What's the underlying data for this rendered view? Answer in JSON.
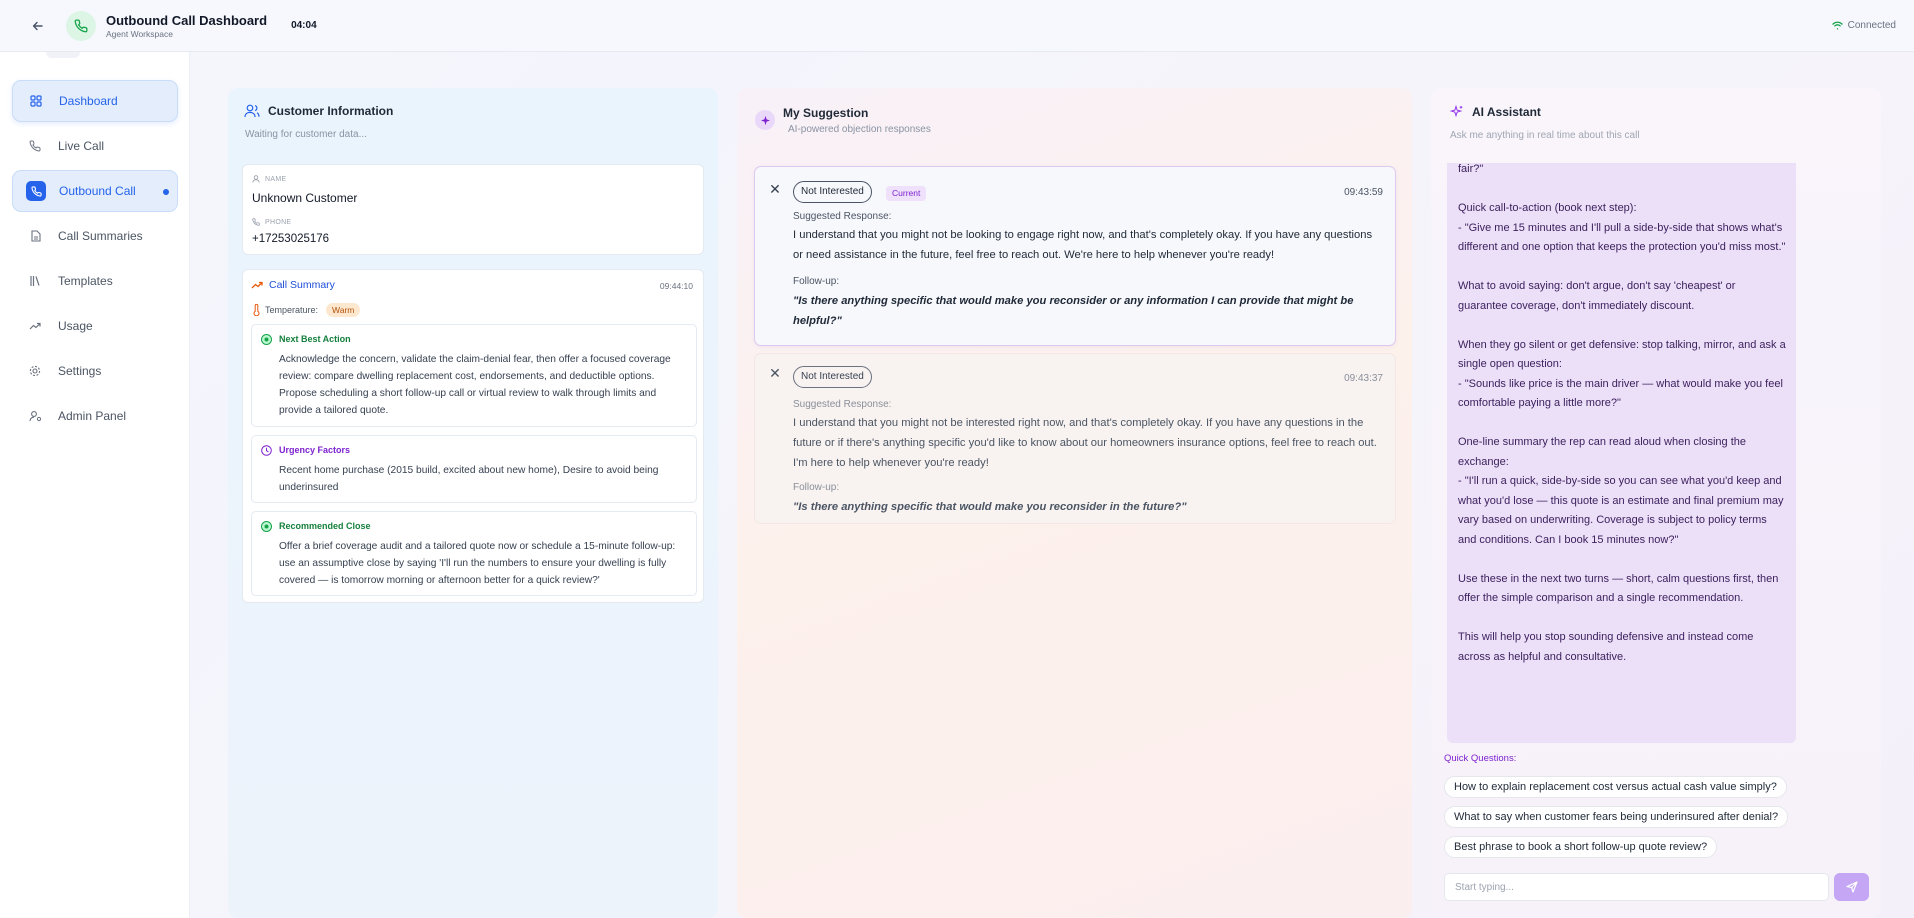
{
  "header": {
    "title": "Outbound Call Dashboard",
    "subtitle": "Agent Workspace",
    "timer": "04:04",
    "status": "Connected",
    "icons": [
      "back-arrow-icon",
      "phone-icon",
      "wifi-icon"
    ]
  },
  "sidebar": {
    "items": [
      {
        "label": "Dashboard",
        "icon": "grid-icon"
      },
      {
        "label": "Live Call",
        "icon": "phone-icon"
      },
      {
        "label": "Outbound Call",
        "icon": "phone-outgoing-icon"
      },
      {
        "label": "Call Summaries",
        "icon": "file-icon"
      },
      {
        "label": "Templates",
        "icon": "library-icon"
      },
      {
        "label": "Usage",
        "icon": "trend-icon"
      },
      {
        "label": "Settings",
        "icon": "gear-icon"
      },
      {
        "label": "Admin Panel",
        "icon": "user-cog-icon"
      }
    ]
  },
  "customer": {
    "title": "Customer Information",
    "subtitle": "Waiting for customer data...",
    "name_caption": "NAME",
    "name": "Unknown Customer",
    "phone_caption": "PHONE",
    "phone": "+17253025176",
    "summary": {
      "title": "Call Summary",
      "time": "09:44:10",
      "temperature_label": "Temperature:",
      "temperature": "Warm",
      "next_best_action": {
        "title": "Next Best Action",
        "text": "Acknowledge the concern, validate the claim-denial fear, then offer a focused coverage review: compare dwelling replacement cost, endorsements, and deductible options. Propose scheduling a short follow-up call or virtual review to walk through limits and provide a tailored quote."
      },
      "urgency": {
        "title": "Urgency Factors",
        "text": "Recent home purchase (2015 build, excited about new home), Desire to avoid being underinsured"
      },
      "close": {
        "title": "Recommended Close",
        "text": "Offer a brief coverage audit and a tailored quote now or schedule a 15-minute follow-up: use an assumptive close by saying 'I'll run the numbers to ensure your dwelling is fully covered — is tomorrow morning or afternoon better for a quick review?'"
      }
    }
  },
  "suggestion": {
    "title": "My Suggestion",
    "subtitle": "AI-powered objection responses",
    "cards": [
      {
        "tag": "Not Interested",
        "current": "Current",
        "time": "09:43:59",
        "response_label": "Suggested Response:",
        "response": "I understand that you might not be looking to engage right now, and that's completely okay. If you have any questions or need assistance in the future, feel free to reach out. We're here to help whenever you're ready!",
        "followup_label": "Follow-up:",
        "followup": "\"Is there anything specific that would make you reconsider or any information I can provide that might be helpful?\""
      },
      {
        "tag": "Not Interested",
        "time": "09:43:37",
        "response_label": "Suggested Response:",
        "response": "I understand that you might not be interested right now, and that's completely okay. If you have any questions in the future or if there's anything specific you'd like to know about our homeowners insurance options, feel free to reach out. I'm here to help whenever you're ready!",
        "followup_label": "Follow-up:",
        "followup": "\"Is there anything specific that would make you reconsider in the future?\""
      }
    ]
  },
  "assistant": {
    "title": "AI Assistant",
    "subtitle": "Ask me anything in real time about this call",
    "message": "fair?\"\n\nQuick call-to-action (book next step):\n- \"Give me 15 minutes and I'll pull a side-by-side that shows what's different and one option that keeps the protection you'd miss most.\"\n\nWhat to avoid saying: don't argue, don't say 'cheapest' or guarantee coverage, don't immediately discount.\n\nWhen they go silent or get defensive: stop talking, mirror, and ask a single open question:\n- \"Sounds like price is the main driver — what would make you feel comfortable paying a little more?\"\n\nOne-line summary the rep can read aloud when closing the exchange:\n- \"I'll run a quick, side-by-side so you can see what you'd keep and what you'd lose — this quote is an estimate and final premium may vary based on underwriting. Coverage is subject to policy terms and conditions. Can I book 15 minutes now?\"\n\nUse these in the next two turns — short, calm questions first, then offer the simple comparison and a single recommendation.\n\nThis will help you stop sounding defensive and instead come across as helpful and consultative.",
    "quick_label": "Quick Questions:",
    "quick": [
      "How to explain replacement cost versus actual cash value simply?",
      "What to say when customer fears being underinsured after denial?",
      "Best phrase to book a short follow-up quote review?"
    ],
    "input_placeholder": "Start typing..."
  },
  "colors": {
    "accent": "#2563eb",
    "assistant_bubble": "#ecdff8",
    "send_button": "#c4a6f4",
    "warm_badge": "#fde7cf",
    "green_title": "#15803d",
    "purple_title": "#7e22ce"
  }
}
